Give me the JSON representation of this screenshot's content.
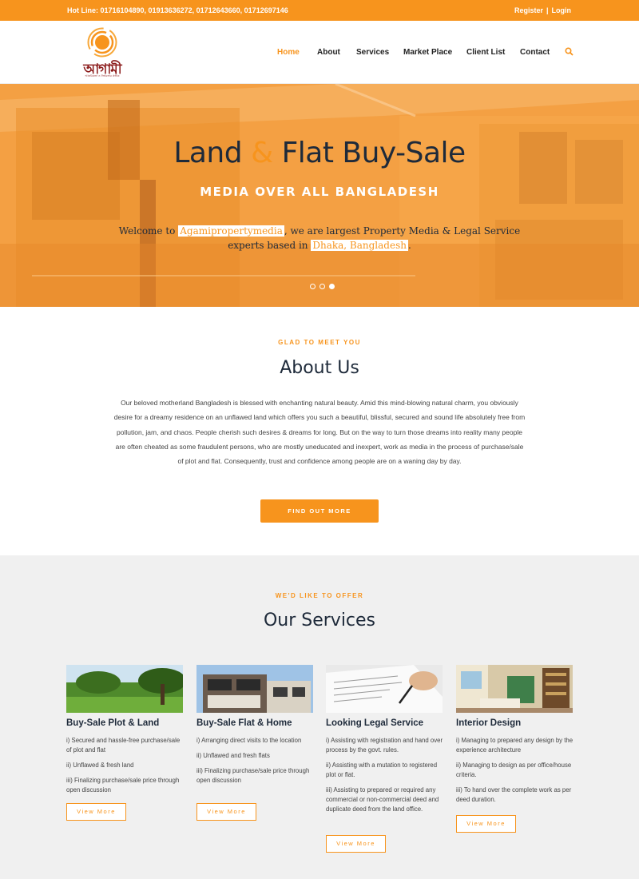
{
  "topbar": {
    "hotline": "Hot Line: 01716104890, 01913636272, 01712643660, 01712697146",
    "register": "Register",
    "separator": "|",
    "login": "Login"
  },
  "brand": {
    "logo_text": "আগামী",
    "tagline": "আন্তরিকতা ও নির্ভরতার প্রতীক"
  },
  "nav": {
    "items": [
      "Home",
      "About",
      "Services",
      "Market Place",
      "Client List",
      "Contact"
    ],
    "active": "Home",
    "accent": "#f7941d"
  },
  "hero": {
    "title_part1": "Land",
    "title_amp": "&",
    "title_part2": "Flat Buy-Sale",
    "subtitle": "MEDIA OVER ALL BANGLADESH",
    "text_before": "Welcome to",
    "highlight_1": "Agamipropertymedia",
    "text_middle": ", we are largest Property Media & Legal Service experts based in",
    "highlight_2": "Dhaka, Bangladesh",
    "text_end": ".",
    "slide_count": 3,
    "active_slide": 3
  },
  "about": {
    "eyebrow": "GLAD TO MEET YOU",
    "title": "About Us",
    "body": "Our beloved motherland Bangladesh is blessed with enchanting natural beauty. Amid this mind-blowing natural charm, you obviously desire for a dreamy residence on an unflawed land which offers you such a beautiful, blissful, secured and sound life absolutely free from pollution, jam, and chaos. People cherish such desires & dreams for long. But on the way to turn those dreams into reality many people are often cheated as some fraudulent persons, who are mostly uneducated and inexpert, work as media in the process of purchase/sale of plot and flat. Consequently, trust and confidence among people are on a waning day by day.",
    "button": "FIND OUT MORE"
  },
  "services": {
    "eyebrow": "WE'D LIKE TO OFFER",
    "title": "Our Services",
    "cards": [
      {
        "title": "Buy-Sale Plot & Land",
        "image_icon": "land-photo",
        "items": [
          "i) Secured and hassle-free purchase/sale of plot and flat",
          "ii) Unflawed & fresh land",
          "iii) Finalizing purchase/sale price through open discussion"
        ],
        "button": "View More"
      },
      {
        "title": "Buy-Sale Flat & Home",
        "image_icon": "building-photo",
        "items": [
          "i) Arranging direct visits to the location",
          "ii) Unflawed and fresh flats",
          "iii) Finalizing purchase/sale price through open discussion"
        ],
        "button": "View More"
      },
      {
        "title": "Looking Legal Service",
        "image_icon": "document-signing-photo",
        "items": [
          "i) Assisting with registration and hand over process by the govt. rules.",
          "ii) Assisting with a mutation to registered plot or flat.",
          "iii) Assisting to prepared or required any commercial or non-commercial deed and duplicate deed from the land office."
        ],
        "button": "View More"
      },
      {
        "title": "Interior Design",
        "image_icon": "interior-room-photo",
        "items": [
          "i) Managing to prepared any design by the experience architecture",
          "ii) Managing to design as per office/house criteria.",
          "iii) To hand over the complete work as per deed duration."
        ],
        "button": "View More"
      }
    ]
  },
  "colors": {
    "accent": "#f7941d",
    "dark_text": "#1e2a3a",
    "section_bg": "#f0f0f0"
  }
}
